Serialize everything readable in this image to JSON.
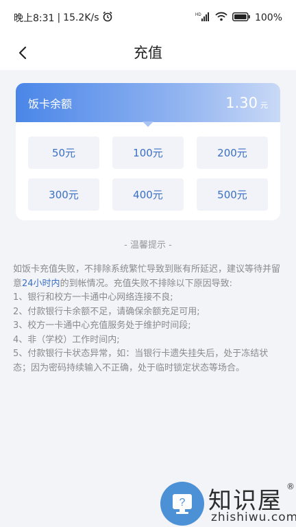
{
  "status_bar": {
    "time": "晚上8:31",
    "separator": "|",
    "speed": "15.2K/s",
    "battery": "100%"
  },
  "nav": {
    "title": "充值"
  },
  "card": {
    "balance_label": "饭卡余额",
    "balance_amount": "1.30",
    "balance_unit": "元",
    "amounts": [
      "50元",
      "100元",
      "200元",
      "300元",
      "400元",
      "500元"
    ]
  },
  "tips": {
    "title": "- 温馨提示 -",
    "intro_part1": "如饭卡充值失败，不排除系统繁忙导致到账有所延迟，建议等待并留意",
    "intro_highlight": "24小时内",
    "intro_part2": "的到帐情况。充值失败不排除以下原因导致:",
    "items": [
      "1、银行和校方一卡通中心网络连接不良;",
      "2、付款银行卡余额不足，请确保余额充足可用;",
      "3、校方一卡通中心充值服务处于维护时间段;",
      "4、非（学校）工作时间内;",
      "5、付款银行卡状态异常，如：当银行卡遗失挂失后，处于冻结状态；因为密码持续输入不正确，处于临时锁定状态等场合。"
    ]
  },
  "watermark": {
    "name": "知识屋",
    "reg": "®",
    "url": "zhishiwu.com"
  },
  "colors": {
    "accent": "#3a6fc4",
    "header_gradient_start": "#4a86e8",
    "background": "#f3f4f8"
  }
}
